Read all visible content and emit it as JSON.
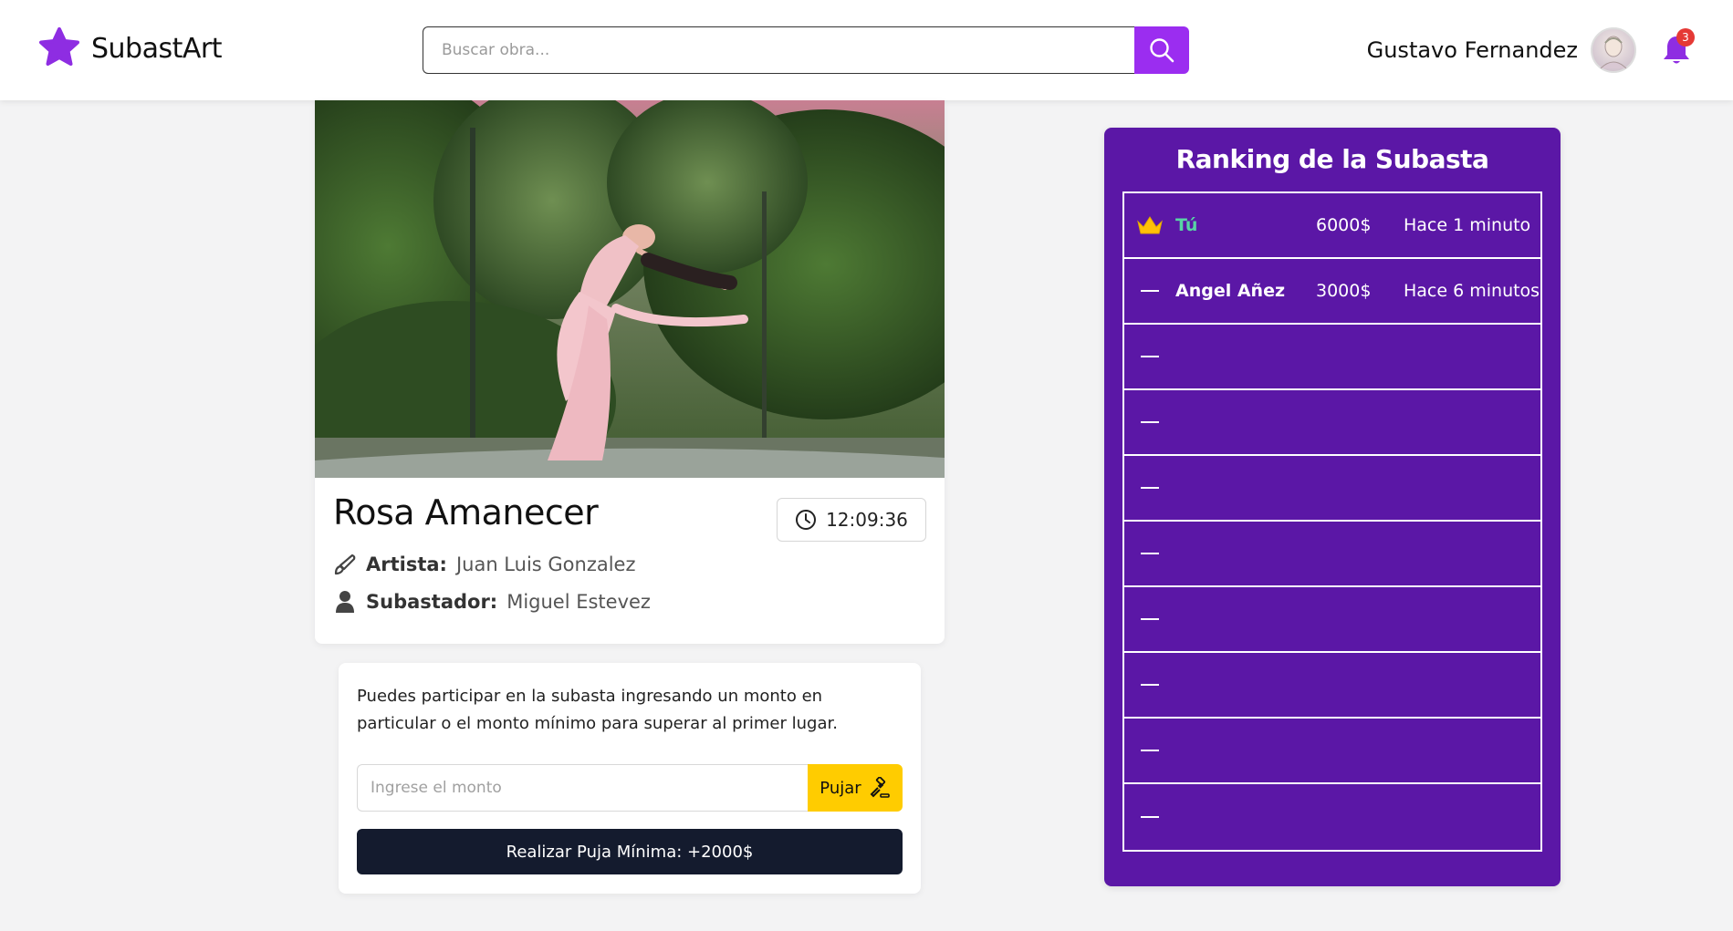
{
  "header": {
    "brand": "SubastArt",
    "search_placeholder": "Buscar obra...",
    "user_name": "Gustavo Fernandez",
    "notification_count": "3",
    "colors": {
      "accent": "#9b2df0",
      "logo": "#8e2de2",
      "badge": "#e53935"
    }
  },
  "artwork": {
    "title": "Rosa Amanecer",
    "timer": "12:09:36",
    "artist_label": "Artista:",
    "artist": "Juan Luis Gonzalez",
    "auctioneer_label": "Subastador:",
    "auctioneer": "Miguel Estevez"
  },
  "bid": {
    "text": "Puedes participar en la subasta ingresando un monto en particular o el monto mínimo para superar al primer lugar.",
    "input_placeholder": "Ingrese el monto",
    "pujar_label": "Pujar",
    "min_bid_label": "Realizar Puja Mínima: +2000$",
    "colors": {
      "pujar": "#ffcc00",
      "min_bid": "#141b2e"
    }
  },
  "ranking": {
    "title": "Ranking de la Subasta",
    "colors": {
      "background": "#5b17a6",
      "you": "#58d4a4",
      "crown": "#ffc107"
    },
    "rows": [
      {
        "mark": "crown-icon",
        "name": "Tú",
        "amount": "6000$",
        "time": "Hace 1 minuto"
      },
      {
        "mark": "dash",
        "name": "Angel Añez",
        "amount": "3000$",
        "time": "Hace 6 minutos"
      },
      {
        "mark": "dash",
        "name": "",
        "amount": "",
        "time": ""
      },
      {
        "mark": "dash",
        "name": "",
        "amount": "",
        "time": ""
      },
      {
        "mark": "dash",
        "name": "",
        "amount": "",
        "time": ""
      },
      {
        "mark": "dash",
        "name": "",
        "amount": "",
        "time": ""
      },
      {
        "mark": "dash",
        "name": "",
        "amount": "",
        "time": ""
      },
      {
        "mark": "dash",
        "name": "",
        "amount": "",
        "time": ""
      },
      {
        "mark": "dash",
        "name": "",
        "amount": "",
        "time": ""
      },
      {
        "mark": "dash",
        "name": "",
        "amount": "",
        "time": ""
      }
    ]
  }
}
